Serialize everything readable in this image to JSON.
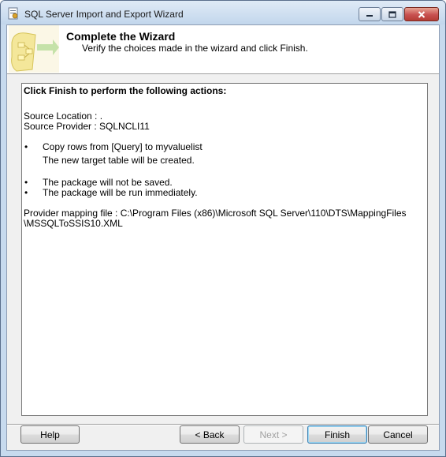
{
  "window": {
    "title": "SQL Server Import and Export Wizard"
  },
  "header": {
    "title": "Complete the Wizard",
    "subtitle": "Verify the choices made in the wizard and click Finish."
  },
  "summary": {
    "heading": "Click Finish to perform the following actions:",
    "source_location": "Source Location : .",
    "source_provider": "Source Provider : SQLNCLI11",
    "action1": "Copy rows from [Query] to myvaluelist",
    "action1_detail": "The new target table will be created.",
    "action2": "The package will not be saved.",
    "action3": "The package will be run immediately.",
    "mapping_line1": "Provider mapping file : C:\\Program Files (x86)\\Microsoft SQL Server\\110\\DTS\\MappingFiles",
    "mapping_line2": "\\MSSQLToSSIS10.XML",
    "bullet": "•"
  },
  "buttons": {
    "help": "Help",
    "back": "< Back",
    "next": "Next >",
    "finish": "Finish",
    "cancel": "Cancel"
  }
}
